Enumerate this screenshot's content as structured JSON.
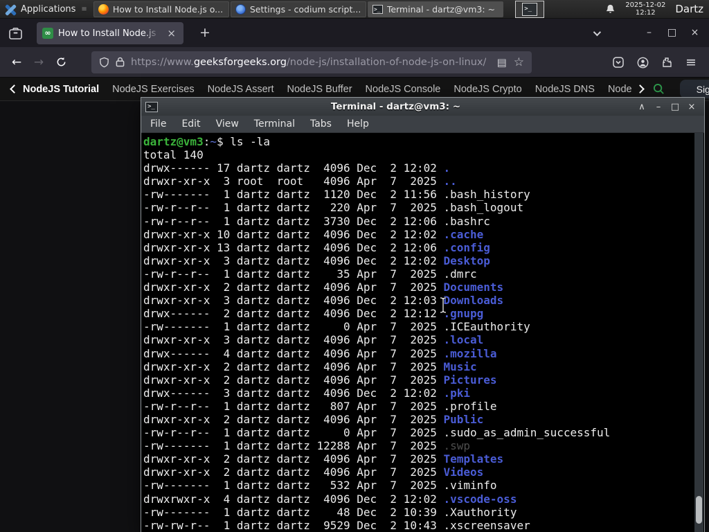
{
  "colors": {
    "tabbar_bg": "#1c1b22",
    "tab_bg": "#42414d",
    "toolbar_bg": "#2b2a33",
    "gfg_green": "#2f8d46",
    "term_title_bg": "#44484c",
    "term_menu_bg": "#3c4045",
    "prompt_green": "#3bb33b",
    "path_blue": "#5f74d8",
    "dir_blue": "#4a5cd6",
    "dim_name": "#4e4e4e"
  },
  "icons": {
    "menu_grip": "≡",
    "terminal_glyph": ">_",
    "new_tab": "+",
    "tab_close": "×",
    "minimize": "–",
    "maximize": "□",
    "close": "×",
    "back": "←",
    "forward": "→",
    "reader": "▤",
    "star": "☆",
    "hamburger": "≡",
    "shade": "∧",
    "favicon_glyph": "∞"
  },
  "panel": {
    "applications_label": "Applications",
    "windows": [
      {
        "title": "How to Install Node.js o...",
        "icon": "firefox"
      },
      {
        "title": "Settings - codium script...",
        "icon": "settings"
      },
      {
        "title": "Terminal - dartz@vm3: ~",
        "icon": "terminal"
      }
    ],
    "clock_date": "2025-12-02",
    "clock_time": "12:12",
    "user_label": "Dartz"
  },
  "browser": {
    "tab_title": "How to Install Node.js on",
    "url_prefix": "https://www.",
    "url_domain": "geeksforgeeks.org",
    "url_path": "/node-js/installation-of-node-js-on-linux/"
  },
  "site_nav": {
    "primary": "NodeJS Tutorial",
    "links": [
      "NodeJS Exercises",
      "NodeJS Assert",
      "NodeJS Buffer",
      "NodeJS Console",
      "NodeJS Crypto",
      "NodeJS DNS",
      "Node"
    ],
    "sign_in_label": "Sign In"
  },
  "terminal": {
    "window_title": "Terminal - dartz@vm3: ~",
    "menu_items": [
      "File",
      "Edit",
      "View",
      "Terminal",
      "Tabs",
      "Help"
    ],
    "prompt": {
      "user_host": "dartz@vm3",
      "colon": ":",
      "path": "~",
      "dollar": "$",
      "command": "ls -la"
    },
    "total_line": "total 140",
    "listing": [
      {
        "perms": "drwx------",
        "links": "17",
        "owner": "dartz",
        "group": "dartz",
        "size": "4096",
        "month": "Dec",
        "day": "2",
        "time": "12:02",
        "name": ".",
        "kind": "dir"
      },
      {
        "perms": "drwxr-xr-x",
        "links": "3",
        "owner": "root",
        "group": "root",
        "size": "4096",
        "month": "Apr",
        "day": "7",
        "time": "2025",
        "name": "..",
        "kind": "dir"
      },
      {
        "perms": "-rw-------",
        "links": "1",
        "owner": "dartz",
        "group": "dartz",
        "size": "1120",
        "month": "Dec",
        "day": "2",
        "time": "11:56",
        "name": ".bash_history",
        "kind": "file"
      },
      {
        "perms": "-rw-r--r--",
        "links": "1",
        "owner": "dartz",
        "group": "dartz",
        "size": "220",
        "month": "Apr",
        "day": "7",
        "time": "2025",
        "name": ".bash_logout",
        "kind": "file"
      },
      {
        "perms": "-rw-r--r--",
        "links": "1",
        "owner": "dartz",
        "group": "dartz",
        "size": "3730",
        "month": "Dec",
        "day": "2",
        "time": "12:06",
        "name": ".bashrc",
        "kind": "file"
      },
      {
        "perms": "drwxr-xr-x",
        "links": "10",
        "owner": "dartz",
        "group": "dartz",
        "size": "4096",
        "month": "Dec",
        "day": "2",
        "time": "12:02",
        "name": ".cache",
        "kind": "dir"
      },
      {
        "perms": "drwxr-xr-x",
        "links": "13",
        "owner": "dartz",
        "group": "dartz",
        "size": "4096",
        "month": "Dec",
        "day": "2",
        "time": "12:06",
        "name": ".config",
        "kind": "dir"
      },
      {
        "perms": "drwxr-xr-x",
        "links": "3",
        "owner": "dartz",
        "group": "dartz",
        "size": "4096",
        "month": "Dec",
        "day": "2",
        "time": "12:02",
        "name": "Desktop",
        "kind": "dir"
      },
      {
        "perms": "-rw-r--r--",
        "links": "1",
        "owner": "dartz",
        "group": "dartz",
        "size": "35",
        "month": "Apr",
        "day": "7",
        "time": "2025",
        "name": ".dmrc",
        "kind": "file"
      },
      {
        "perms": "drwxr-xr-x",
        "links": "2",
        "owner": "dartz",
        "group": "dartz",
        "size": "4096",
        "month": "Apr",
        "day": "7",
        "time": "2025",
        "name": "Documents",
        "kind": "dir"
      },
      {
        "perms": "drwxr-xr-x",
        "links": "3",
        "owner": "dartz",
        "group": "dartz",
        "size": "4096",
        "month": "Dec",
        "day": "2",
        "time": "12:03",
        "name": "Downloads",
        "kind": "dir"
      },
      {
        "perms": "drwx------",
        "links": "2",
        "owner": "dartz",
        "group": "dartz",
        "size": "4096",
        "month": "Dec",
        "day": "2",
        "time": "12:12",
        "name": ".gnupg",
        "kind": "dir"
      },
      {
        "perms": "-rw-------",
        "links": "1",
        "owner": "dartz",
        "group": "dartz",
        "size": "0",
        "month": "Apr",
        "day": "7",
        "time": "2025",
        "name": ".ICEauthority",
        "kind": "file"
      },
      {
        "perms": "drwxr-xr-x",
        "links": "3",
        "owner": "dartz",
        "group": "dartz",
        "size": "4096",
        "month": "Apr",
        "day": "7",
        "time": "2025",
        "name": ".local",
        "kind": "dir"
      },
      {
        "perms": "drwx------",
        "links": "4",
        "owner": "dartz",
        "group": "dartz",
        "size": "4096",
        "month": "Apr",
        "day": "7",
        "time": "2025",
        "name": ".mozilla",
        "kind": "dir"
      },
      {
        "perms": "drwxr-xr-x",
        "links": "2",
        "owner": "dartz",
        "group": "dartz",
        "size": "4096",
        "month": "Apr",
        "day": "7",
        "time": "2025",
        "name": "Music",
        "kind": "dir"
      },
      {
        "perms": "drwxr-xr-x",
        "links": "2",
        "owner": "dartz",
        "group": "dartz",
        "size": "4096",
        "month": "Apr",
        "day": "7",
        "time": "2025",
        "name": "Pictures",
        "kind": "dir"
      },
      {
        "perms": "drwx------",
        "links": "3",
        "owner": "dartz",
        "group": "dartz",
        "size": "4096",
        "month": "Dec",
        "day": "2",
        "time": "12:02",
        "name": ".pki",
        "kind": "dir"
      },
      {
        "perms": "-rw-r--r--",
        "links": "1",
        "owner": "dartz",
        "group": "dartz",
        "size": "807",
        "month": "Apr",
        "day": "7",
        "time": "2025",
        "name": ".profile",
        "kind": "file"
      },
      {
        "perms": "drwxr-xr-x",
        "links": "2",
        "owner": "dartz",
        "group": "dartz",
        "size": "4096",
        "month": "Apr",
        "day": "7",
        "time": "2025",
        "name": "Public",
        "kind": "dir"
      },
      {
        "perms": "-rw-r--r--",
        "links": "1",
        "owner": "dartz",
        "group": "dartz",
        "size": "0",
        "month": "Apr",
        "day": "7",
        "time": "2025",
        "name": ".sudo_as_admin_successful",
        "kind": "file"
      },
      {
        "perms": "-rw-------",
        "links": "1",
        "owner": "dartz",
        "group": "dartz",
        "size": "12288",
        "month": "Apr",
        "day": "7",
        "time": "2025",
        "name": ".swp",
        "kind": "dim"
      },
      {
        "perms": "drwxr-xr-x",
        "links": "2",
        "owner": "dartz",
        "group": "dartz",
        "size": "4096",
        "month": "Apr",
        "day": "7",
        "time": "2025",
        "name": "Templates",
        "kind": "dir"
      },
      {
        "perms": "drwxr-xr-x",
        "links": "2",
        "owner": "dartz",
        "group": "dartz",
        "size": "4096",
        "month": "Apr",
        "day": "7",
        "time": "2025",
        "name": "Videos",
        "kind": "dir"
      },
      {
        "perms": "-rw-------",
        "links": "1",
        "owner": "dartz",
        "group": "dartz",
        "size": "532",
        "month": "Apr",
        "day": "7",
        "time": "2025",
        "name": ".viminfo",
        "kind": "file"
      },
      {
        "perms": "drwxrwxr-x",
        "links": "4",
        "owner": "dartz",
        "group": "dartz",
        "size": "4096",
        "month": "Dec",
        "day": "2",
        "time": "12:02",
        "name": ".vscode-oss",
        "kind": "dir"
      },
      {
        "perms": "-rw-------",
        "links": "1",
        "owner": "dartz",
        "group": "dartz",
        "size": "48",
        "month": "Dec",
        "day": "2",
        "time": "10:39",
        "name": ".Xauthority",
        "kind": "file"
      },
      {
        "perms": "-rw-rw-r--",
        "links": "1",
        "owner": "dartz",
        "group": "dartz",
        "size": "9529",
        "month": "Dec",
        "day": "2",
        "time": "10:43",
        "name": ".xscreensaver",
        "kind": "file"
      }
    ]
  }
}
